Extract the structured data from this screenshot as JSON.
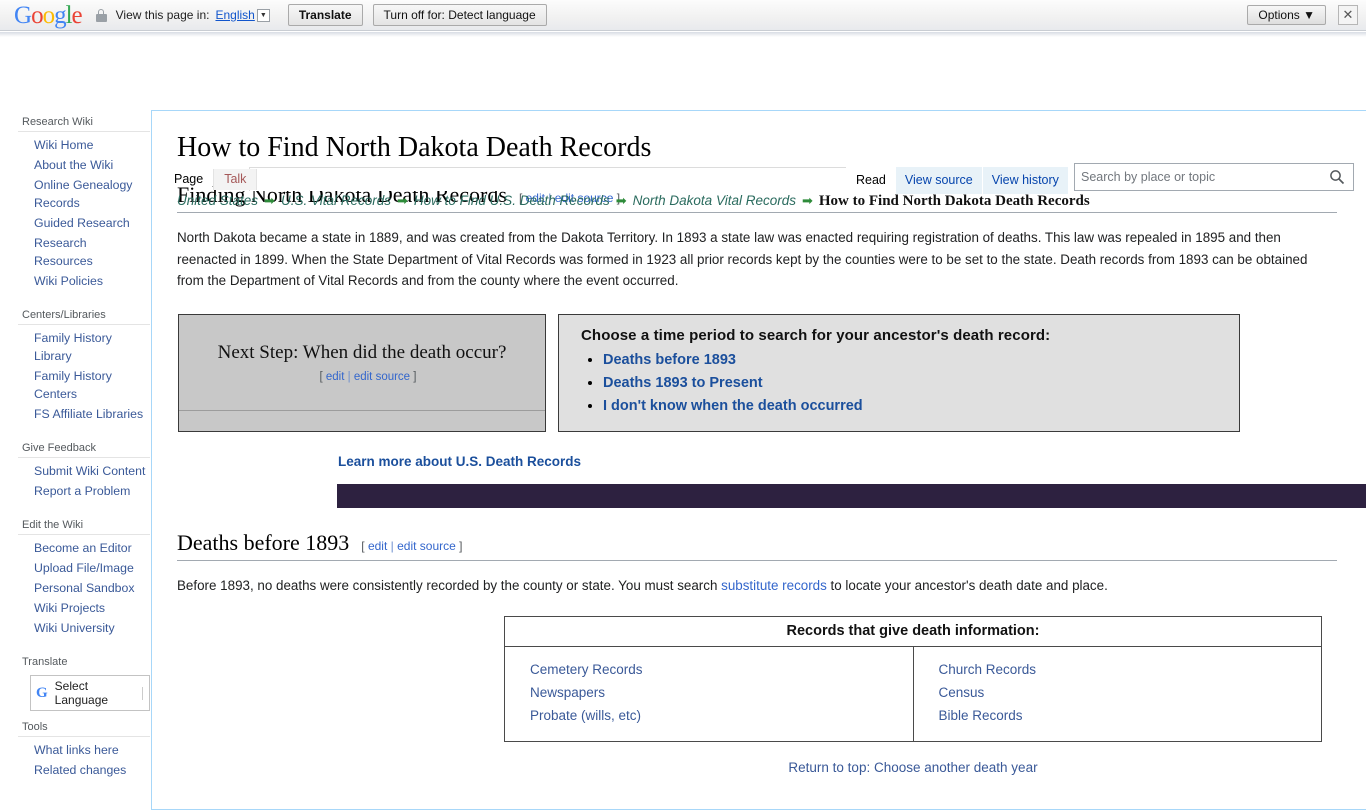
{
  "translate_bar": {
    "logo_letters": [
      "G",
      "o",
      "o",
      "g",
      "l",
      "e"
    ],
    "lock_icon": "lock-icon",
    "view_label": "View this page in:",
    "language": "English",
    "caret_icon": "chevron-down-icon",
    "translate_button": "Translate",
    "turn_off_button": "Turn off for: Detect language",
    "options_button": "Options ▼",
    "close_icon": "✕"
  },
  "sidebar": {
    "groups": [
      {
        "heading": "Research Wiki",
        "items": [
          "Wiki Home",
          "About the Wiki",
          "Online Genealogy Records",
          "Guided Research",
          "Research Resources",
          "Wiki Policies"
        ]
      },
      {
        "heading": "Centers/Libraries",
        "items": [
          "Family History Library",
          "Family History Centers",
          "FS Affiliate Libraries"
        ]
      },
      {
        "heading": "Give Feedback",
        "items": [
          "Submit Wiki Content",
          "Report a Problem"
        ]
      },
      {
        "heading": "Edit the Wiki",
        "items": [
          "Become an Editor",
          "Upload File/Image",
          "Personal Sandbox",
          "Wiki Projects",
          "Wiki University"
        ]
      }
    ],
    "translate_heading": "Translate",
    "select_language": "Select Language",
    "google_mini_logo": "G",
    "tools_heading": "Tools",
    "tools_items": [
      "What links here",
      "Related changes"
    ]
  },
  "page": {
    "title": "How to Find North Dakota Death Records",
    "tabs_left": [
      {
        "label": "Page",
        "state": "selected"
      },
      {
        "label": "Talk",
        "state": "talk"
      }
    ],
    "tabs_right": [
      {
        "label": "Read",
        "state": "read"
      },
      {
        "label": "View source",
        "state": "normal"
      },
      {
        "label": "View history",
        "state": "normal"
      }
    ],
    "search": {
      "placeholder": "Search by place or topic",
      "value": "",
      "icon": "search-icon"
    },
    "breadcrumb": {
      "items": [
        "United States",
        "U.S. Vital Records",
        "How to Find U.S. Death Records",
        "North Dakota Vital Records"
      ],
      "current": "How to Find North Dakota Death Records",
      "arrow": "➡"
    }
  },
  "sections": {
    "finding": {
      "title": "Finding North Dakota Death Records",
      "edit": "edit",
      "edit_source": "edit source",
      "paragraph": "North Dakota became a state in 1889, and was created from the Dakota Territory. In 1893 a state law was enacted requiring registration of deaths. This law was repealed in 1895 and then reenacted in 1899. When the State Department of Vital Records was formed in 1923 all prior records kept by the counties were to be set to the state. Death records from 1893 can be obtained from the Department of Vital Records and from the county where the event occurred."
    },
    "next_step": {
      "text": "Next Step: When did the death occur?",
      "edit": "edit",
      "edit_source": "edit source"
    },
    "choose": {
      "title": "Choose a time period to search for your ancestor's death record:",
      "options": [
        "Deaths before 1893",
        "Deaths 1893 to Present",
        "I don't know when the death occurred"
      ]
    },
    "learn_more": "Learn more about U.S. Death Records",
    "deaths_before": {
      "title": "Deaths before 1893",
      "edit": "edit",
      "edit_source": "edit source",
      "para_before": "Before 1893, no deaths were consistently recorded by the county or state. You must search ",
      "para_link": "substitute records",
      "para_after": " to locate your ancestor's death date and place."
    },
    "records_table": {
      "header": "Records that give death information:",
      "left_column": [
        "Cemetery Records",
        "Newspapers",
        "Probate (wills, etc)"
      ],
      "right_column": [
        "Church Records",
        "Census",
        "Bible Records"
      ]
    },
    "return_to_top": "Return to top: Choose another death year"
  },
  "colors": {
    "dark_bar": "#2d2140",
    "link": "#3a5998",
    "breadcrumb_link": "#2a6b5e",
    "arrow_green": "#2e8b3a"
  }
}
